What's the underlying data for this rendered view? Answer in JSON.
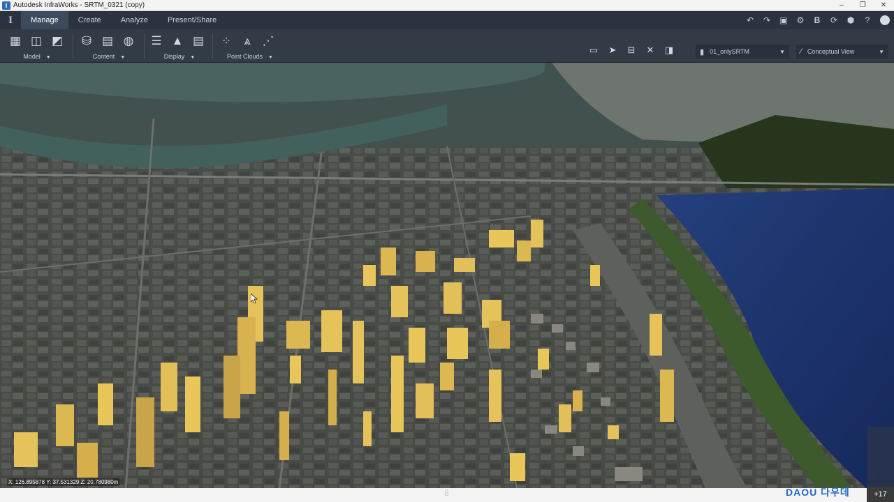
{
  "window": {
    "title": "Autodesk InfraWorks - SRTM_0321 (copy)",
    "controls": [
      "–",
      "❐",
      "✕"
    ]
  },
  "menubar": {
    "logo": "I",
    "tabs": [
      {
        "label": "Manage",
        "active": true
      },
      {
        "label": "Create",
        "active": false
      },
      {
        "label": "Analyze",
        "active": false
      },
      {
        "label": "Present/Share",
        "active": false
      }
    ],
    "right_icons": [
      "undo-icon",
      "redo-icon",
      "capture-icon",
      "settings-icon",
      "bim-icon",
      "sync-icon",
      "cube-icon",
      "help-icon",
      "user-avatar"
    ]
  },
  "ribbon": {
    "groups": [
      {
        "label": "Model",
        "icons": [
          "model-table-icon",
          "model-layout-icon",
          "model-sheet-icon"
        ]
      },
      {
        "label": "Content",
        "icons": [
          "database-icon",
          "building-list-icon",
          "globe-icon"
        ]
      },
      {
        "label": "Display",
        "icons": [
          "layers-icon",
          "terrain-icon",
          "list-icon"
        ]
      },
      {
        "label": "Point Clouds",
        "icons": [
          "point-cloud-icon",
          "point-terrain-icon",
          "point-filter-icon"
        ]
      }
    ],
    "tools": [
      "presentation-icon",
      "select-icon",
      "measure-icon",
      "explode-icon",
      "section-icon"
    ],
    "proposal_dropdown": "01_onlySRTM",
    "view_dropdown": "Conceptual View"
  },
  "status": {
    "coords": "X: 126.895878 Y: 37.531329 Z: 20.780980m",
    "page_number": "8",
    "watermark": "DAOU 다우데",
    "overlay_count": "+17"
  },
  "colors": {
    "accent": "#2e6db4",
    "ribbon": "#333b47",
    "menubar": "#2b3340",
    "river": "#1d3a7a",
    "building": "#e8c65a"
  }
}
